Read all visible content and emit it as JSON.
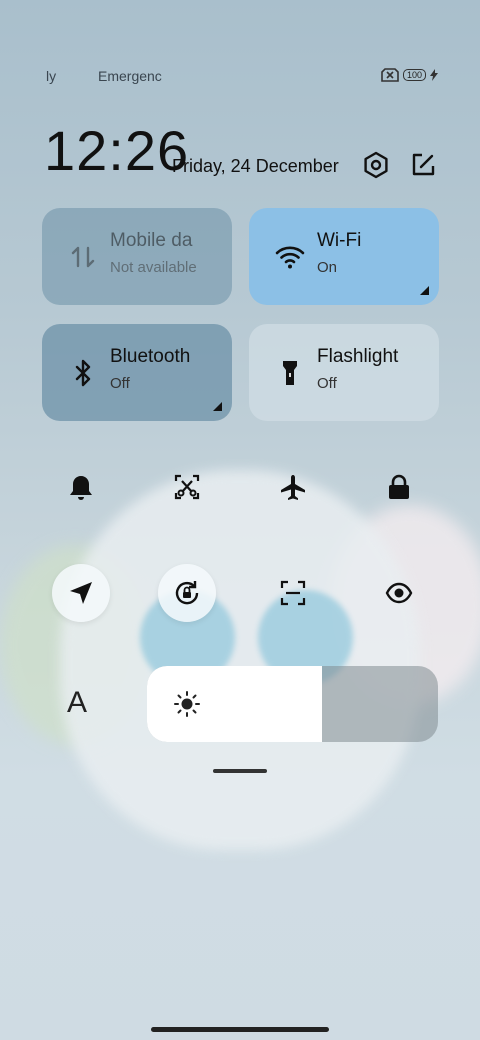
{
  "status_bar": {
    "left_text": "ly",
    "carrier_text": "Emergenc",
    "battery_level": "100"
  },
  "header": {
    "time": "12:26",
    "date": "Friday, 24 December"
  },
  "tiles": {
    "mobile_data": {
      "title": "Mobile da",
      "subtitle": "Not available",
      "state": "disabled"
    },
    "wifi": {
      "title": "Wi-Fi",
      "subtitle": "On",
      "state": "on"
    },
    "bluetooth": {
      "title": "Bluetooth",
      "subtitle": "Off",
      "state": "off"
    },
    "flashlight": {
      "title": "Flashlight",
      "subtitle": "Off",
      "state": "off"
    }
  },
  "quick_toggles_row1": [
    "bell-icon",
    "screenshot-icon",
    "airplane-icon",
    "lock-icon"
  ],
  "quick_toggles_row2": [
    "location-icon",
    "rotation-lock-icon",
    "scan-icon",
    "eye-icon"
  ],
  "font_size_label": "A",
  "brightness": {
    "level": 0.6
  },
  "colors": {
    "tile_active": "#8cc0e6",
    "tile_dark": "#7e9eb2",
    "tile_light": "#c5d3dc"
  }
}
